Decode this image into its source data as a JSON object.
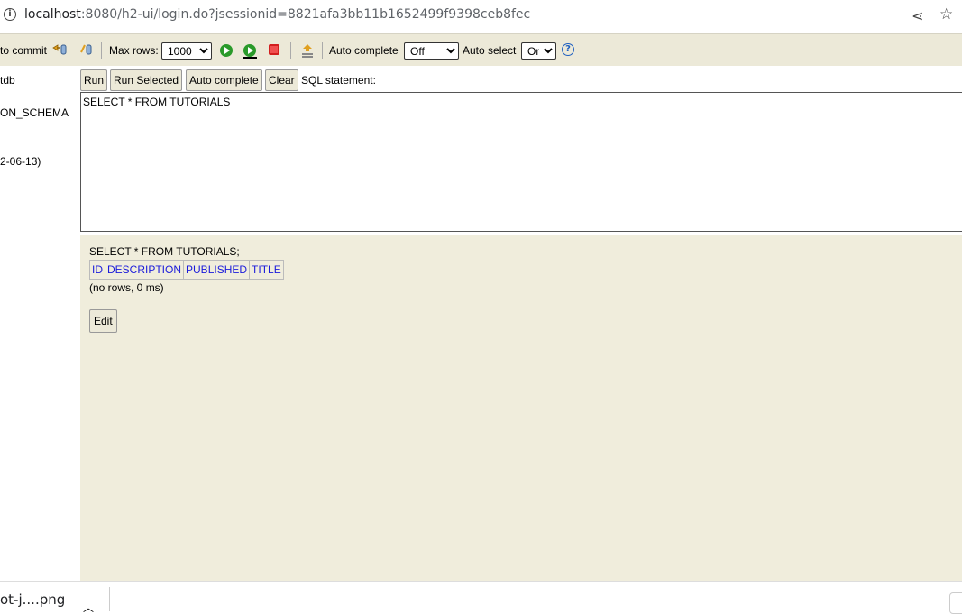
{
  "browser": {
    "url_host": "localhost",
    "url_rest": ":8080/h2-ui/login.do?jsessionid=8821afa3bb11b1652499f9398ceb8fec"
  },
  "toolbar": {
    "auto_commit_label": "to commit",
    "max_rows_label": "Max rows:",
    "max_rows_value": "1000",
    "auto_complete_label": "Auto complete",
    "auto_complete_value": "Off",
    "auto_select_label": "Auto select",
    "auto_select_value": "On",
    "help_symbol": "?"
  },
  "tree": {
    "items": [
      "tdb",
      "ON_SCHEMA",
      "2-06-13)"
    ]
  },
  "query": {
    "buttons": {
      "run": "Run",
      "run_selected": "Run Selected",
      "auto_complete": "Auto complete",
      "clear": "Clear"
    },
    "sql_label": "SQL statement:",
    "sql_text": "SELECT * FROM TUTORIALS"
  },
  "result": {
    "statement": "SELECT * FROM TUTORIALS;",
    "columns": [
      "ID",
      "DESCRIPTION",
      "PUBLISHED",
      "TITLE"
    ],
    "summary": "(no rows, 0 ms)",
    "edit_label": "Edit"
  },
  "downloads": {
    "file_name": "ot-j....png"
  },
  "colors": {
    "panel_bg": "#ece9d8",
    "result_bg": "#f0eddc",
    "column_link": "#1a1adb",
    "run_green": "#2a9a2a",
    "stop_red": "#d21f1f"
  }
}
